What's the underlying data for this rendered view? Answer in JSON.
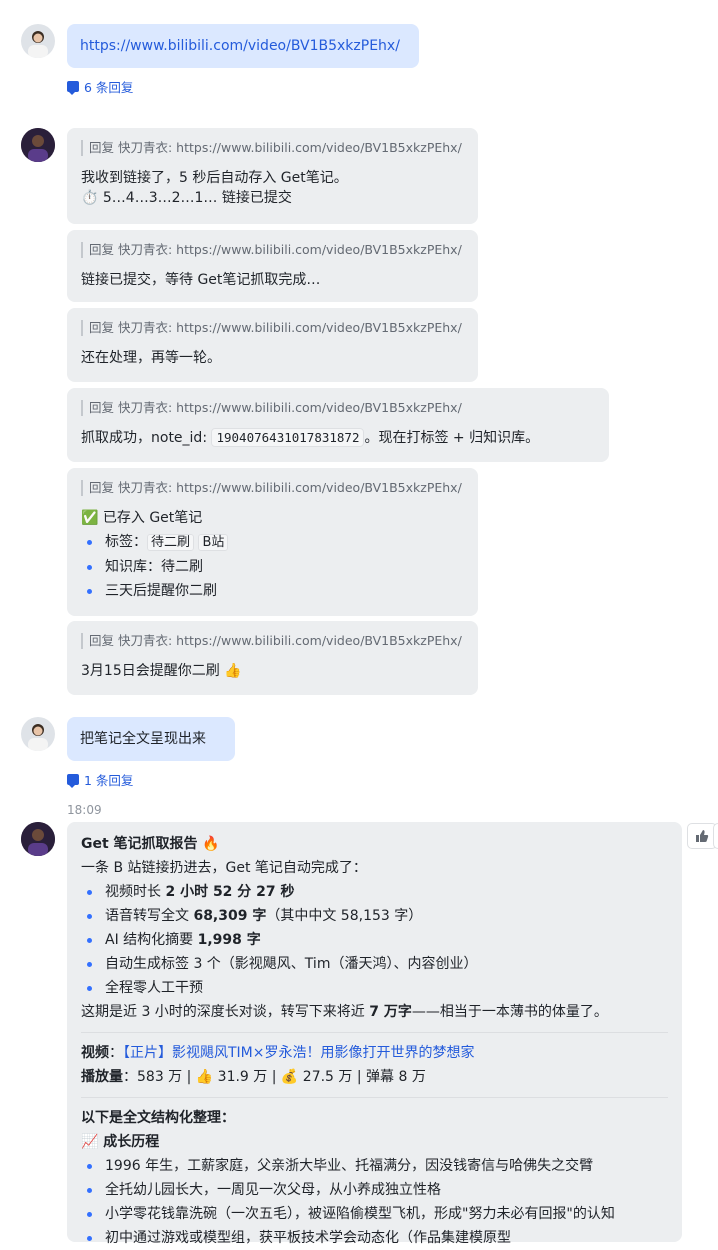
{
  "msg1": {
    "link": "https://www.bilibili.com/video/BV1B5xkzPEhx/",
    "replies": "6 条回复"
  },
  "quote_text": "回复 快刀青衣: https://www.bilibili.com/video/BV1B5xkzPEhx/",
  "r1": {
    "line1": "我收到链接了，5 秒后自动存入 Get笔记。",
    "line2": "⏱️ 5…4…3…2…1… 链接已提交"
  },
  "r2": {
    "text": "链接已提交，等待 Get笔记抓取完成…"
  },
  "r3": {
    "text": "还在处理，再等一轮。"
  },
  "r4": {
    "pre": "抓取成功，note_id: ",
    "code": "1904076431017831872",
    "post": "。现在打标签 + 归知识库。"
  },
  "r5": {
    "title": "✅ 已存入 Get笔记",
    "tags_label": "标签：",
    "tag1": "待二刷",
    "tag2": "B站",
    "kb": "知识库：待二刷",
    "remind": "三天后提醒你二刷"
  },
  "r6": {
    "text": "3月15日会提醒你二刷 👍"
  },
  "msg2": {
    "text": "把笔记全文呈现出来",
    "replies": "1 条回复"
  },
  "time": "18:09",
  "report": {
    "title": "Get 笔记抓取报告 🔥",
    "intro": "一条 B 站链接扔进去，Get 笔记自动完成了：",
    "b1_pre": "视频时长 ",
    "b1_bold": "2 小时 52 分 27 秒",
    "b2_pre": "语音转写全文 ",
    "b2_bold": "68,309 字",
    "b2_post": "（其中中文 58,153 字）",
    "b3_pre": "AI 结构化摘要 ",
    "b3_bold": "1,998 字",
    "b4": "自动生成标签 3 个（影视飓风、Tim（潘天鸿）、内容创业）",
    "b5": "全程零人工干预",
    "summary_pre": "这期是近 3 小时的深度长对谈，转写下来将近 ",
    "summary_bold": "7 万字",
    "summary_post": "——相当于一本薄书的体量了。",
    "video_label": "视频",
    "video_title": "【正片】影视飓风TIM×罗永浩！用影像打开世界的梦想家",
    "plays_label": "播放量",
    "plays_stats": "583 万 | 👍 31.9 万 | 💰 27.5 万 | 弹幕 8 万",
    "structured": "以下是全文结构化整理：",
    "section": "📈 成长历程",
    "g1": "1996 年生，工薪家庭，父亲浙大毕业、托福满分，因没钱寄信与哈佛失之交臂",
    "g2": "全托幼儿园长大，一周见一次父母，从小养成独立性格",
    "g3": "小学零花钱靠洗碗（一次五毛），被诬陷偷模型飞机，形成\"努力未必有回报\"的认知",
    "g4": "初中通过游戏或模型组，获平板技术学会动态化（作品集建模原型"
  }
}
